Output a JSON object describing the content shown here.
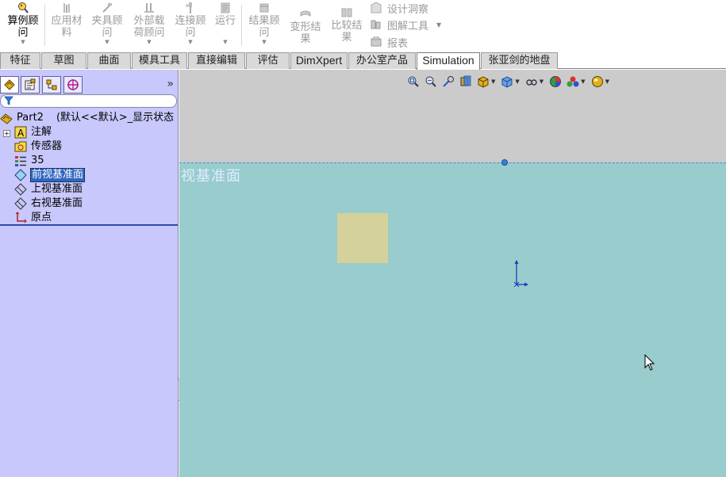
{
  "ribbon": {
    "buttons": [
      {
        "label": "算例顾\n问",
        "icon": "study-advisor-icon",
        "active": true
      },
      {
        "label": "应用材\n料",
        "icon": "apply-material-icon",
        "active": false
      },
      {
        "label": "夹具顾\n问",
        "icon": "fixtures-advisor-icon",
        "active": false
      },
      {
        "label": "外部载\n荷顾问",
        "icon": "external-loads-icon",
        "active": false
      },
      {
        "label": "连接顾\n问",
        "icon": "connections-advisor-icon",
        "active": false
      },
      {
        "label": "运行",
        "icon": "run-icon",
        "active": false
      },
      {
        "label": "结果顾\n问",
        "icon": "results-advisor-icon",
        "active": false
      },
      {
        "label": "变形结\n果",
        "icon": "deformed-result-icon",
        "active": false
      },
      {
        "label": "比较结\n果",
        "icon": "compare-results-icon",
        "active": false
      }
    ],
    "small_buttons": [
      {
        "label": "设计洞察",
        "icon": "design-insight-icon"
      },
      {
        "label": "图解工具",
        "icon": "plot-tools-icon"
      },
      {
        "label": "报表",
        "icon": "report-icon"
      }
    ]
  },
  "tabs": [
    {
      "label": "特征"
    },
    {
      "label": "草图"
    },
    {
      "label": "曲面"
    },
    {
      "label": "模具工具"
    },
    {
      "label": "直接编辑"
    },
    {
      "label": "评估"
    },
    {
      "label": "DimXpert"
    },
    {
      "label": "办公室产品"
    },
    {
      "label": "Simulation",
      "active": true
    },
    {
      "label": "张亚剑的地盘"
    }
  ],
  "panel": {
    "tabs": [
      "feature-manager-icon",
      "property-manager-icon",
      "configuration-manager-icon",
      "dimxpert-manager-icon"
    ],
    "expand_glyph": "»"
  },
  "tree": {
    "part": {
      "name": "Part2",
      "config": "(默认<<默认>_显示状态"
    },
    "items": [
      {
        "label": "注解",
        "icon": "annotations-icon",
        "expandable": true
      },
      {
        "label": "传感器",
        "icon": "sensors-icon"
      },
      {
        "label": "35",
        "icon": "material-icon"
      },
      {
        "label": "前视基准面",
        "icon": "plane-icon",
        "selected": true
      },
      {
        "label": "上视基准面",
        "icon": "plane-icon"
      },
      {
        "label": "右视基准面",
        "icon": "plane-icon"
      },
      {
        "label": "原点",
        "icon": "origin-icon"
      }
    ]
  },
  "viewport": {
    "plane_label": "视基准面",
    "colors": {
      "background": "#99cccc",
      "top_band": "#cbcbcb",
      "sketch": "#d4d29a"
    }
  }
}
